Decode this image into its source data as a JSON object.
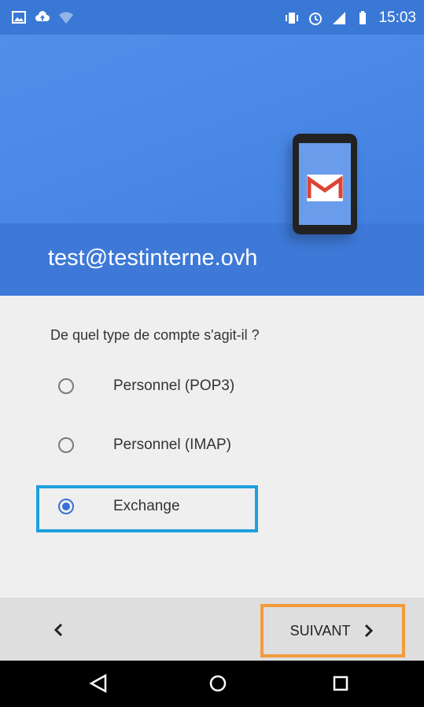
{
  "status_bar": {
    "time": "15:03",
    "icons_left": [
      "image-notification-icon",
      "cloud-upload-icon",
      "wifi-icon"
    ],
    "icons_right": [
      "vibrate-icon",
      "alarm-icon",
      "signal-icon",
      "battery-icon"
    ]
  },
  "header": {
    "account_email": "test@testinterne.ovh",
    "colors": {
      "primary": "#4a88e6",
      "dark": "#3e79d8"
    }
  },
  "form": {
    "question": "De quel type de compte s'agit-il ?",
    "options": [
      {
        "label": "Personnel (POP3)",
        "selected": false
      },
      {
        "label": "Personnel (IMAP)",
        "selected": false
      },
      {
        "label": "Exchange",
        "selected": true
      }
    ]
  },
  "footer": {
    "back_icon": "chevron-left-icon",
    "next_label": "SUIVANT",
    "next_icon": "chevron-right-icon"
  },
  "navigation": {
    "buttons": [
      "back-triangle-icon",
      "home-circle-icon",
      "recent-square-icon"
    ]
  },
  "highlights": {
    "blue": "#1ea0dc",
    "orange": "#f29a3c"
  }
}
